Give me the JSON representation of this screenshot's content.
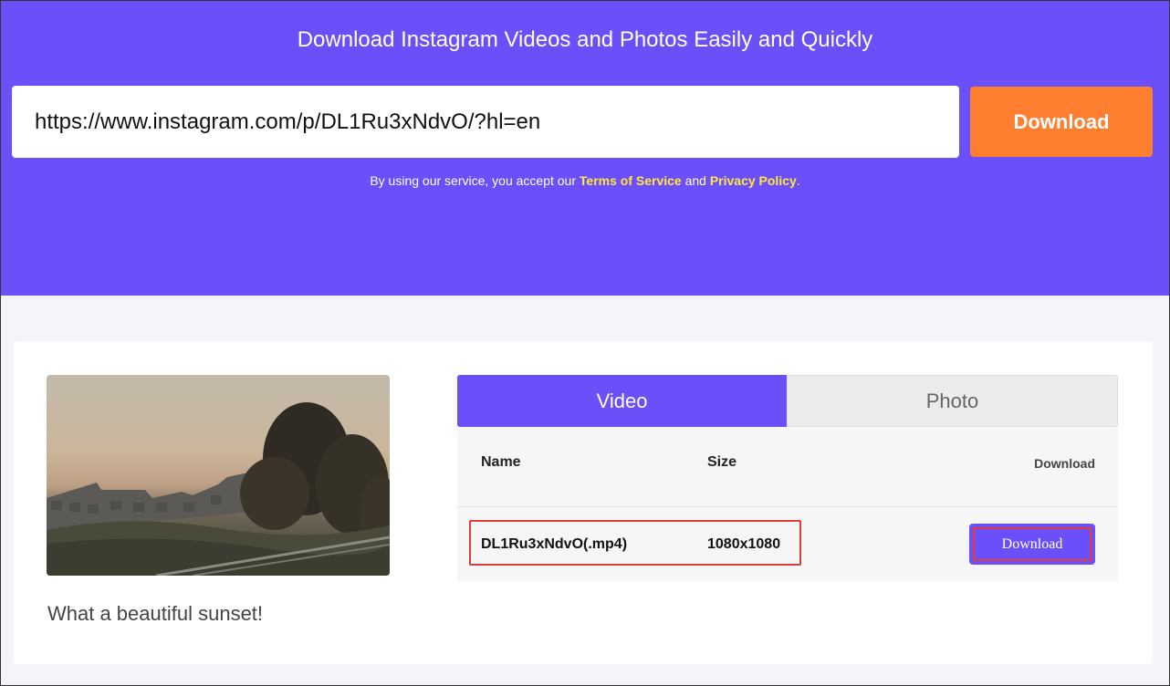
{
  "header": {
    "title": "Download Instagram Videos and Photos Easily and Quickly",
    "url_value": "https://www.instagram.com/p/DL1Ru3xNdvO/?hl=en",
    "download_label": "Download",
    "terms_prefix": "By using our service, you accept our ",
    "terms_link": "Terms of Service",
    "terms_and": " and ",
    "privacy_link": "Privacy Policy",
    "terms_suffix": "."
  },
  "result": {
    "caption": "What a beautiful sunset!",
    "thumbnail_icon": "sunset-photo",
    "tabs": [
      {
        "label": "Video",
        "active": true
      },
      {
        "label": "Photo",
        "active": false
      }
    ],
    "table": {
      "headers": {
        "name": "Name",
        "size": "Size",
        "download": "Download"
      },
      "rows": [
        {
          "name": "DL1Ru3xNdvO(.mp4)",
          "size": "1080x1080",
          "button": "Download"
        }
      ]
    }
  },
  "colors": {
    "brand_purple": "#6b4ff8",
    "download_orange": "#ff7f30",
    "link_yellow": "#ffe83a",
    "highlight_red": "#e03c3c"
  }
}
